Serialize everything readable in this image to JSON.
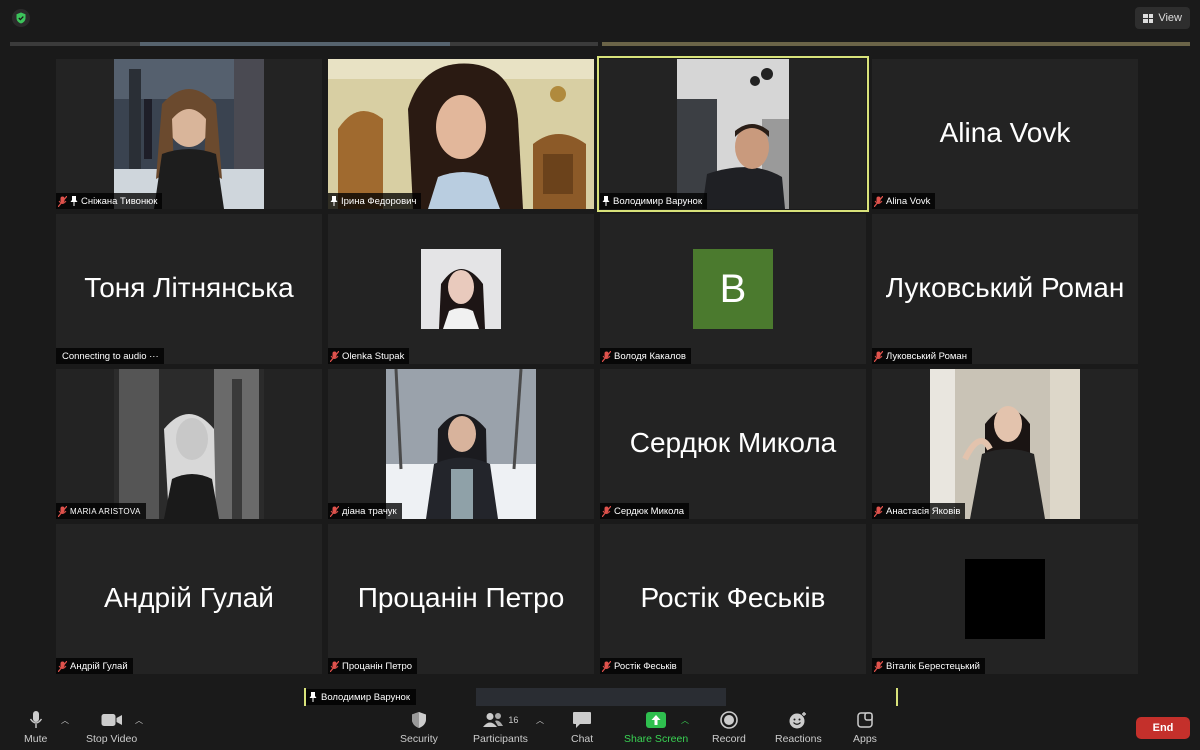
{
  "header": {
    "view_label": "View"
  },
  "tiles": [
    {
      "name": "Сніжана Тивонюк",
      "muted": true,
      "pinned": true
    },
    {
      "name": "Ірина Федорович",
      "muted": false,
      "pinned": true
    },
    {
      "name": "Володимир Варунок",
      "muted": false,
      "pinned": true,
      "active": true
    },
    {
      "name": "Alina Vovk",
      "big": "Alina Vovk",
      "muted": true
    },
    {
      "status": "Connecting to audio ···",
      "big": "Тоня Літнянська"
    },
    {
      "name": "Olenka Stupak",
      "muted": true
    },
    {
      "name": "Володя Какалов",
      "muted": true,
      "avatar_letter": "B"
    },
    {
      "name": "Луковський Роман",
      "big": "Луковський Роман",
      "muted": true
    },
    {
      "name": "MARIA ARISTOVA",
      "muted": true
    },
    {
      "name": "діана трачук",
      "muted": true
    },
    {
      "name": "Сердюк Микола",
      "big": "Сердюк Микола",
      "muted": true
    },
    {
      "name": "Анастасія Яковів",
      "muted": true
    },
    {
      "name": "Андрій Гулай",
      "big": "Андрій Гулай",
      "muted": true
    },
    {
      "name": "Процанін Петро",
      "big": "Процанін Петро",
      "muted": true
    },
    {
      "name": "Ростік Феськів",
      "big": "Ростік Феськів",
      "muted": true
    },
    {
      "name": "Віталік Берестецький",
      "muted": true
    }
  ],
  "pinned_strip": {
    "name": "Володимир Варунок"
  },
  "toolbar": {
    "mute": "Mute",
    "stop_video": "Stop Video",
    "security": "Security",
    "participants": "Participants",
    "participants_count": "16",
    "chat": "Chat",
    "share_screen": "Share Screen",
    "record": "Record",
    "reactions": "Reactions",
    "apps": "Apps",
    "end": "End"
  },
  "colors": {
    "active_border": "#d8e27a",
    "end_button": "#c4302b",
    "share_green": "#39d353",
    "avatar_green": "#4b7a2e"
  }
}
